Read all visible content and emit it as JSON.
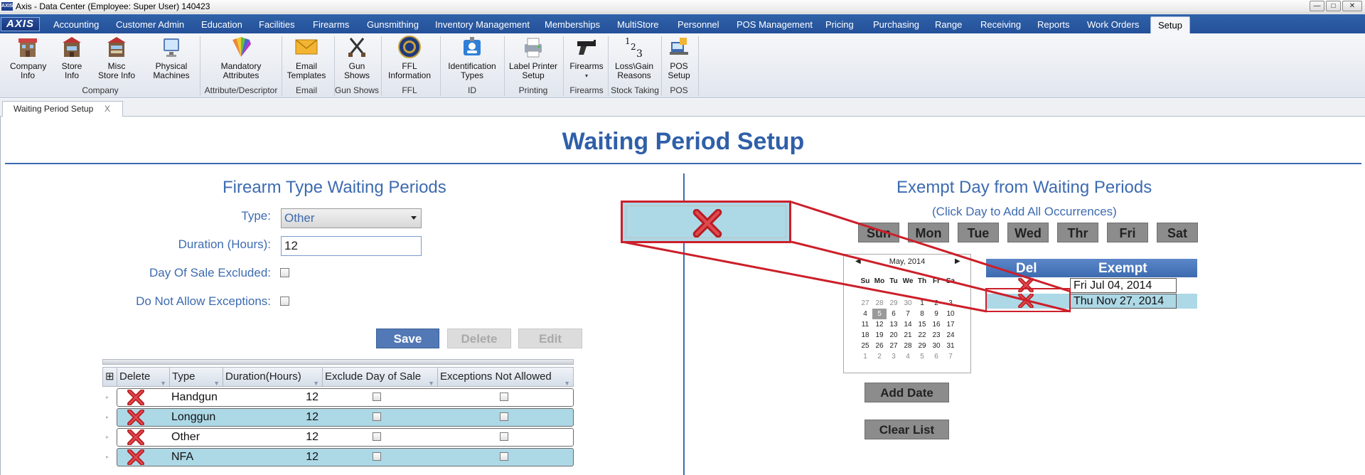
{
  "window": {
    "title": "Axis - Data Center  (Employee: Super User) 140423",
    "app_icon": "AXIS",
    "buttons": {
      "minimize": "—",
      "maximize": "□",
      "close": "✕"
    }
  },
  "menu": {
    "logo": "AXIS",
    "tabs": [
      "Accounting",
      "Customer Admin",
      "Education",
      "Facilities",
      "Firearms",
      "Gunsmithing",
      "Inventory Management",
      "Memberships",
      "MultiStore",
      "Personnel",
      "POS Management",
      "Pricing",
      "Purchasing",
      "Range",
      "Receiving",
      "Reports",
      "Work Orders",
      "Setup"
    ],
    "active_tab": "Setup"
  },
  "ribbon": {
    "buttons": [
      {
        "label": "Company Info",
        "icon": "building-icon"
      },
      {
        "label": "Store Info",
        "icon": "store-icon"
      },
      {
        "label": "Misc Store Info",
        "icon": "store-misc-icon"
      },
      {
        "label": "Physical Machines",
        "icon": "monitor-icon"
      },
      {
        "label": "Mandatory Attributes",
        "icon": "color-fan-icon"
      },
      {
        "label": "Email Templates",
        "icon": "envelope-icon"
      },
      {
        "label": "Gun Shows",
        "icon": "crossed-pistols-icon"
      },
      {
        "label": "FFL Information",
        "icon": "seal-icon"
      },
      {
        "label": "Identification Types",
        "icon": "id-card-icon"
      },
      {
        "label": "Label Printer Setup",
        "icon": "printer-icon"
      },
      {
        "label": "Firearms",
        "icon": "pistol-icon"
      },
      {
        "label": "Loss\\Gain Reasons",
        "icon": "numbers-icon"
      },
      {
        "label": "POS Setup",
        "icon": "pos-icon"
      }
    ],
    "groups": [
      "Company",
      "Attribute/Descriptor",
      "Email",
      "Gun Shows",
      "FFL",
      "ID",
      "Printing",
      "Firearms",
      "Stock Taking",
      "POS"
    ]
  },
  "doc_tab": {
    "label": "Waiting Period Setup",
    "close": "X"
  },
  "page": {
    "title": "Waiting Period Setup"
  },
  "left": {
    "section_title": "Firearm Type Waiting Periods",
    "type_label": "Type:",
    "type_value": "Other",
    "duration_label": "Duration (Hours):",
    "duration_value": "12",
    "day_of_sale_label": "Day Of Sale Excluded:",
    "no_exceptions_label": "Do Not Allow Exceptions:",
    "save": "Save",
    "delete": "Delete",
    "edit": "Edit",
    "grid": {
      "columns": [
        "Delete",
        "Type",
        "Duration(Hours)",
        "Exclude Day of Sale",
        "Exceptions Not Allowed"
      ],
      "rows": [
        {
          "type": "Handgun",
          "duration": "12"
        },
        {
          "type": "Longgun",
          "duration": "12"
        },
        {
          "type": "Other",
          "duration": "12"
        },
        {
          "type": "NFA",
          "duration": "12"
        }
      ]
    }
  },
  "right": {
    "section_title": "Exempt Day from Waiting Periods",
    "subtitle": "(Click Day to Add All Occurrences)",
    "days": [
      "Sun",
      "Mon",
      "Tue",
      "Wed",
      "Thr",
      "Fri",
      "Sat"
    ],
    "calendar": {
      "month": "May, 2014",
      "weekdays": [
        "Su",
        "Mo",
        "Tu",
        "We",
        "Th",
        "Fr",
        "Sa"
      ],
      "weeks": [
        [
          "27",
          "28",
          "29",
          "30",
          "1",
          "2",
          "3"
        ],
        [
          "4",
          "5",
          "6",
          "7",
          "8",
          "9",
          "10"
        ],
        [
          "11",
          "12",
          "13",
          "14",
          "15",
          "16",
          "17"
        ],
        [
          "18",
          "19",
          "20",
          "21",
          "22",
          "23",
          "24"
        ],
        [
          "25",
          "26",
          "27",
          "28",
          "29",
          "30",
          "31"
        ],
        [
          "1",
          "2",
          "3",
          "4",
          "5",
          "6",
          "7"
        ]
      ],
      "selected": "5"
    },
    "add_date": "Add Date",
    "clear_list": "Clear List",
    "exempt_grid": {
      "columns": [
        "Del",
        "Exempt"
      ],
      "rows": [
        "Fri Jul 04, 2014",
        "Thu Nov 27, 2014"
      ]
    }
  },
  "colors": {
    "accent": "#3d6bb0",
    "row_alt": "#add8e6",
    "callout": "#cc1f2a",
    "menubar": "#2a58a0"
  }
}
